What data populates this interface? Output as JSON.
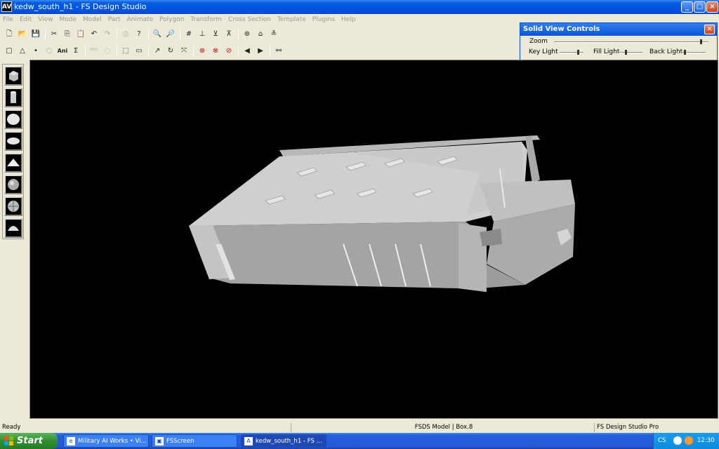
{
  "window": {
    "app_icon": "AV",
    "title": "kedw_south_h1 - FS Design Studio",
    "btn_min": "_",
    "btn_max": "□",
    "btn_close": "×"
  },
  "menu": [
    "File",
    "Edit",
    "View",
    "Mode",
    "Model",
    "Part",
    "Animate",
    "Polygon",
    "Transform",
    "Cross Section",
    "Template",
    "Plugins",
    "Help"
  ],
  "toolbar1": [
    "new-icon",
    "open-icon",
    "save-icon",
    "|",
    "cut-icon",
    "copy-icon",
    "paste-icon",
    "undo-icon",
    "redo-icon",
    "|",
    "print-icon",
    "help-icon",
    "|",
    "zoom-in-icon",
    "zoom-out-icon",
    "|",
    "grid-icon",
    "align-x-icon",
    "align-y-icon",
    "align-z-icon",
    "|",
    "view-icon",
    "home-icon",
    "settings-icon"
  ],
  "toolbar2_text": {
    "ani": "Ani",
    "sigma": "Σ"
  },
  "solid_view": {
    "title": "Solid View Controls",
    "close": "✕",
    "zoom": "Zoom",
    "key_light": "Key Light",
    "fill_light": "Fill Light",
    "back_light": "Back Light",
    "zoom_level": 0.96,
    "key_light_level": 0.8,
    "fill_light_level": 0.3,
    "back_light_level": 0.1
  },
  "palette": [
    "cube-icon",
    "cylinder-icon",
    "sphere-icon",
    "ellipse-icon",
    "pyramid-icon",
    "textured-sphere-icon",
    "textured-globe-icon",
    "dome-icon"
  ],
  "status": {
    "ready": "Ready",
    "model": "FSDS Model | Box.8",
    "product": "FS Design Studio Pro"
  },
  "taskbar": {
    "start": "Start",
    "tasks": [
      {
        "label": "Military AI Works • Vi...",
        "icon": "e"
      },
      {
        "label": "FSScreen",
        "icon": "▣"
      },
      {
        "label": "kedw_south_h1 - FS ...",
        "icon": "A"
      }
    ],
    "lang": "CS",
    "clock": "12:30"
  },
  "colors": {
    "title_blue": "#0054e3",
    "viewport_bg": "#000000",
    "model_light": "#c9c9c9",
    "model_dark": "#9a9a9a"
  }
}
